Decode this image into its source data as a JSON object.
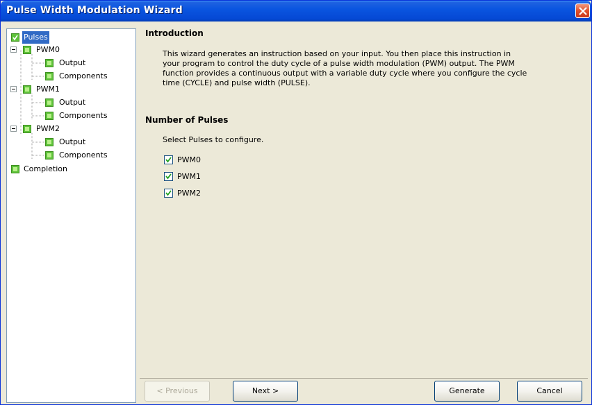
{
  "window": {
    "title": "Pulse Width Modulation Wizard"
  },
  "sidebar": {
    "items": [
      {
        "label": "Pulses",
        "selected": true
      },
      {
        "label": "PWM0"
      },
      {
        "label": "Output"
      },
      {
        "label": "Components"
      },
      {
        "label": "PWM1"
      },
      {
        "label": "Output"
      },
      {
        "label": "Components"
      },
      {
        "label": "PWM2"
      },
      {
        "label": "Output"
      },
      {
        "label": "Components"
      },
      {
        "label": "Completion"
      }
    ]
  },
  "main": {
    "intro_title": "Introduction",
    "intro_lines": [
      "This wizard generates an instruction based on your input. You then place this instruction in",
      "your program to control the duty cycle of a pulse width modulation (PWM) output. The PWM",
      "function provides a continuous output with a variable duty cycle where you configure the cycle",
      "time (CYCLE) and pulse width (PULSE)."
    ],
    "pulses_title": "Number of Pulses",
    "pulses_prompt": "Select Pulses to configure.",
    "checkboxes": [
      {
        "label": "PWM0",
        "checked": true
      },
      {
        "label": "PWM1",
        "checked": true
      },
      {
        "label": "PWM2",
        "checked": true
      }
    ]
  },
  "buttons": {
    "previous": "< Previous",
    "next": "Next >",
    "generate": "Generate",
    "cancel": "Cancel"
  },
  "colors": {
    "titlebar": "#0a55e0",
    "selection": "#316ac5",
    "node_green": "#5ec23a"
  }
}
